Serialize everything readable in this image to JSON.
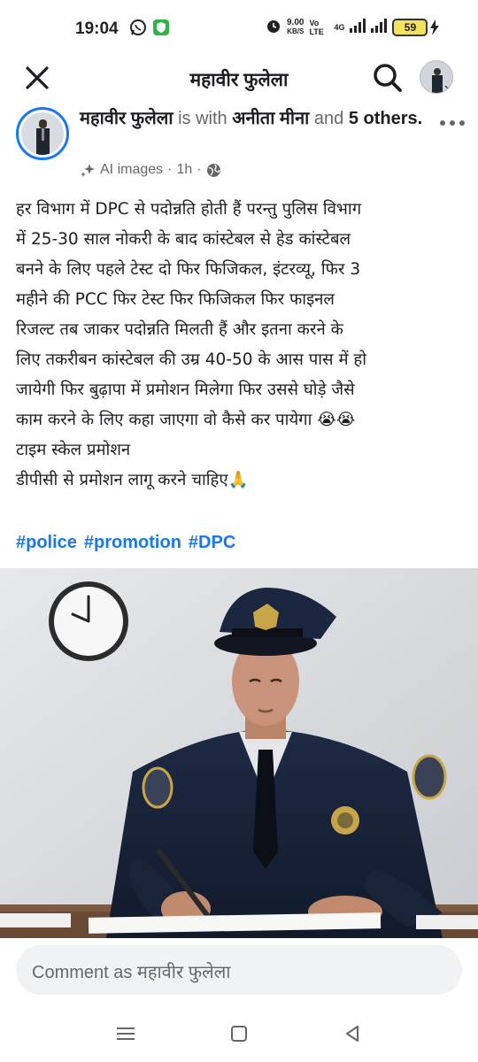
{
  "status_bar": {
    "time": "19:04",
    "speed_value": "9.00",
    "speed_unit": "KB/S",
    "volte": "Vo LTE",
    "network": "4G",
    "battery": "59",
    "icons": [
      "whatsapp-icon",
      "shield-app-icon",
      "alarm-icon",
      "signal-icon",
      "battery-icon",
      "charging-icon"
    ]
  },
  "header": {
    "title": "महावीर फुलेला",
    "icons": [
      "close-icon",
      "search-icon"
    ]
  },
  "post": {
    "author": "महावीर फुलेला",
    "is_with": "is with",
    "tagged": "अनीता मीना",
    "and": "and",
    "others": "5 others.",
    "ai_label": "AI images",
    "separator": "·",
    "time": "1h",
    "separator2": "·",
    "body_lines": [
      "हर विभाग में DPC से पदोन्नति होती हैं परन्तु पुलिस विभाग",
      "में 25-30 साल नोकरी के बाद कांस्टेबल से हेड कांस्टेबल",
      "बनने के लिए  पहले टेस्ट दो फिर फिजिकल, इंटरव्यू, फिर 3",
      "महीने की PCC फिर टेस्ट फिर फिजिकल फिर फाइनल",
      "रिजल्ट तब जाकर पदोन्नति मिलती हैं   और इतना करने के",
      "लिए तकरीबन कांस्टेबल की उम्र 40-50 के आस पास में हो",
      "जायेगी  फिर बुढ़ापा में प्रमोशन मिलेगा फिर उससे घोड़े जैसे",
      "काम करने के लिए कहा जाएगा वो कैसे कर पायेगा  😭😭",
      "टाइम स्केल प्रमोशन",
      "डीपीसी से प्रमोशन      लागू करने चाहिए🙏"
    ],
    "hashtags": [
      "#police",
      "#promotion",
      "#DPC"
    ]
  },
  "comment": {
    "placeholder": "Comment as महावीर फुलेला"
  },
  "nav": {
    "icons": [
      "menu-nav-icon",
      "home-nav-icon",
      "back-nav-icon"
    ]
  },
  "colors": {
    "accent": "#1877f2",
    "battery_fill": "#f2e35a",
    "comment_bg": "#f0f2f5"
  }
}
